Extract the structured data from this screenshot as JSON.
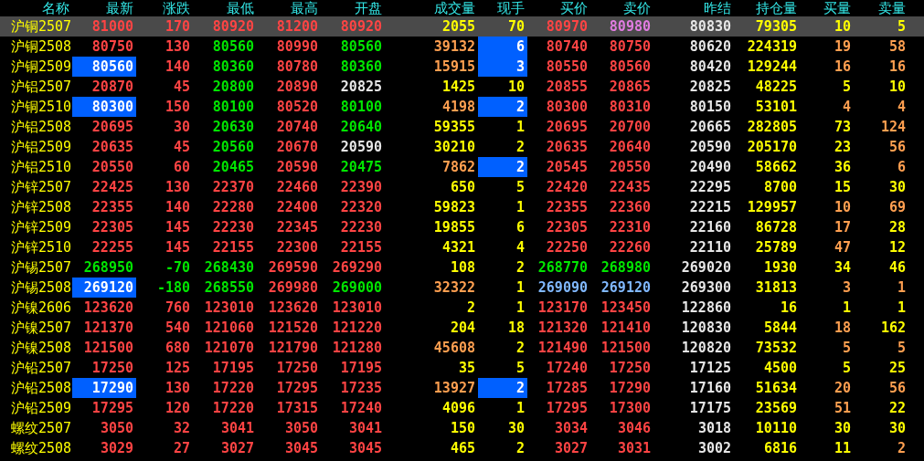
{
  "columns": [
    "名称",
    "最新",
    "涨跌",
    "最低",
    "最高",
    "开盘",
    "成交量",
    "现手",
    "买价",
    "卖价",
    "昨结",
    "持仓量",
    "买量",
    "卖量"
  ],
  "rows": [
    {
      "name": "沪铜2507",
      "selected": true,
      "cells": [
        {
          "text": "81000",
          "color": "#ff4444",
          "highlighted": false
        },
        {
          "text": "170",
          "color": "#ff4444",
          "highlighted": false
        },
        {
          "text": "80920",
          "color": "#ff4444",
          "highlighted": false
        },
        {
          "text": "81200",
          "color": "#ff4444",
          "highlighted": false
        },
        {
          "text": "80920",
          "color": "#ff4444",
          "highlighted": false
        },
        {
          "text": "2055",
          "color": "#ffff00",
          "highlighted": false
        },
        {
          "text": "70",
          "color": "#ffff00",
          "highlighted": false
        },
        {
          "text": "80970",
          "color": "#ff4444",
          "highlighted": false
        },
        {
          "text": "80980",
          "color": "#e07ce0",
          "highlighted": false
        },
        {
          "text": "80830",
          "color": "#e6e6e6",
          "highlighted": false
        },
        {
          "text": "79305",
          "color": "#ffff00",
          "highlighted": false
        },
        {
          "text": "10",
          "color": "#ffff00",
          "highlighted": false
        },
        {
          "text": "5",
          "color": "#ffff00",
          "highlighted": false
        }
      ]
    },
    {
      "name": "沪铜2508",
      "selected": false,
      "cells": [
        {
          "text": "80750",
          "color": "#ff4444",
          "highlighted": false
        },
        {
          "text": "130",
          "color": "#ff4444",
          "highlighted": false
        },
        {
          "text": "80560",
          "color": "#00e600",
          "highlighted": false
        },
        {
          "text": "80990",
          "color": "#ff4444",
          "highlighted": false
        },
        {
          "text": "80560",
          "color": "#00e600",
          "highlighted": false
        },
        {
          "text": "39132",
          "color": "#ff9f50",
          "highlighted": false
        },
        {
          "text": "6",
          "color": "#ffffff",
          "highlighted": true
        },
        {
          "text": "80740",
          "color": "#ff4444",
          "highlighted": false
        },
        {
          "text": "80750",
          "color": "#ff4444",
          "highlighted": false
        },
        {
          "text": "80620",
          "color": "#e6e6e6",
          "highlighted": false
        },
        {
          "text": "224319",
          "color": "#ffff00",
          "highlighted": false
        },
        {
          "text": "19",
          "color": "#ff9f50",
          "highlighted": false
        },
        {
          "text": "58",
          "color": "#ff9f50",
          "highlighted": false
        }
      ]
    },
    {
      "name": "沪铜2509",
      "selected": false,
      "cells": [
        {
          "text": "80560",
          "color": "#ffffff",
          "highlighted": true
        },
        {
          "text": "140",
          "color": "#ff4444",
          "highlighted": false
        },
        {
          "text": "80360",
          "color": "#00e600",
          "highlighted": false
        },
        {
          "text": "80780",
          "color": "#ff4444",
          "highlighted": false
        },
        {
          "text": "80360",
          "color": "#00e600",
          "highlighted": false
        },
        {
          "text": "15915",
          "color": "#ff9f50",
          "highlighted": false
        },
        {
          "text": "3",
          "color": "#ffffff",
          "highlighted": true
        },
        {
          "text": "80550",
          "color": "#ff4444",
          "highlighted": false
        },
        {
          "text": "80560",
          "color": "#ff4444",
          "highlighted": false
        },
        {
          "text": "80420",
          "color": "#e6e6e6",
          "highlighted": false
        },
        {
          "text": "129244",
          "color": "#ffff00",
          "highlighted": false
        },
        {
          "text": "16",
          "color": "#ff9f50",
          "highlighted": false
        },
        {
          "text": "16",
          "color": "#ff9f50",
          "highlighted": false
        }
      ]
    },
    {
      "name": "沪铝2507",
      "selected": false,
      "cells": [
        {
          "text": "20870",
          "color": "#ff4444",
          "highlighted": false
        },
        {
          "text": "45",
          "color": "#ff4444",
          "highlighted": false
        },
        {
          "text": "20800",
          "color": "#00e600",
          "highlighted": false
        },
        {
          "text": "20890",
          "color": "#ff4444",
          "highlighted": false
        },
        {
          "text": "20825",
          "color": "#e6e6e6",
          "highlighted": false
        },
        {
          "text": "1425",
          "color": "#ffff00",
          "highlighted": false
        },
        {
          "text": "10",
          "color": "#ffff00",
          "highlighted": false
        },
        {
          "text": "20855",
          "color": "#ff4444",
          "highlighted": false
        },
        {
          "text": "20865",
          "color": "#ff4444",
          "highlighted": false
        },
        {
          "text": "20825",
          "color": "#e6e6e6",
          "highlighted": false
        },
        {
          "text": "48225",
          "color": "#ffff00",
          "highlighted": false
        },
        {
          "text": "5",
          "color": "#ffff00",
          "highlighted": false
        },
        {
          "text": "10",
          "color": "#ffff00",
          "highlighted": false
        }
      ]
    },
    {
      "name": "沪铜2510",
      "selected": false,
      "cells": [
        {
          "text": "80300",
          "color": "#ffffff",
          "highlighted": true
        },
        {
          "text": "150",
          "color": "#ff4444",
          "highlighted": false
        },
        {
          "text": "80100",
          "color": "#00e600",
          "highlighted": false
        },
        {
          "text": "80520",
          "color": "#ff4444",
          "highlighted": false
        },
        {
          "text": "80100",
          "color": "#00e600",
          "highlighted": false
        },
        {
          "text": "4198",
          "color": "#ff9f50",
          "highlighted": false
        },
        {
          "text": "2",
          "color": "#ffffff",
          "highlighted": true
        },
        {
          "text": "80300",
          "color": "#ff4444",
          "highlighted": false
        },
        {
          "text": "80310",
          "color": "#ff4444",
          "highlighted": false
        },
        {
          "text": "80150",
          "color": "#e6e6e6",
          "highlighted": false
        },
        {
          "text": "53101",
          "color": "#ffff00",
          "highlighted": false
        },
        {
          "text": "4",
          "color": "#ff9f50",
          "highlighted": false
        },
        {
          "text": "4",
          "color": "#ff9f50",
          "highlighted": false
        }
      ]
    },
    {
      "name": "沪铝2508",
      "selected": false,
      "cells": [
        {
          "text": "20695",
          "color": "#ff4444",
          "highlighted": false
        },
        {
          "text": "30",
          "color": "#ff4444",
          "highlighted": false
        },
        {
          "text": "20630",
          "color": "#00e600",
          "highlighted": false
        },
        {
          "text": "20740",
          "color": "#ff4444",
          "highlighted": false
        },
        {
          "text": "20640",
          "color": "#00e600",
          "highlighted": false
        },
        {
          "text": "59355",
          "color": "#ffff00",
          "highlighted": false
        },
        {
          "text": "1",
          "color": "#ffff00",
          "highlighted": false
        },
        {
          "text": "20695",
          "color": "#ff4444",
          "highlighted": false
        },
        {
          "text": "20700",
          "color": "#ff4444",
          "highlighted": false
        },
        {
          "text": "20665",
          "color": "#e6e6e6",
          "highlighted": false
        },
        {
          "text": "282805",
          "color": "#ffff00",
          "highlighted": false
        },
        {
          "text": "73",
          "color": "#ffff00",
          "highlighted": false
        },
        {
          "text": "124",
          "color": "#ff9f50",
          "highlighted": false
        }
      ]
    },
    {
      "name": "沪铝2509",
      "selected": false,
      "cells": [
        {
          "text": "20635",
          "color": "#ff4444",
          "highlighted": false
        },
        {
          "text": "45",
          "color": "#ff4444",
          "highlighted": false
        },
        {
          "text": "20560",
          "color": "#00e600",
          "highlighted": false
        },
        {
          "text": "20670",
          "color": "#ff4444",
          "highlighted": false
        },
        {
          "text": "20590",
          "color": "#e6e6e6",
          "highlighted": false
        },
        {
          "text": "30210",
          "color": "#ffff00",
          "highlighted": false
        },
        {
          "text": "2",
          "color": "#ffff00",
          "highlighted": false
        },
        {
          "text": "20635",
          "color": "#ff4444",
          "highlighted": false
        },
        {
          "text": "20640",
          "color": "#ff4444",
          "highlighted": false
        },
        {
          "text": "20590",
          "color": "#e6e6e6",
          "highlighted": false
        },
        {
          "text": "205170",
          "color": "#ffff00",
          "highlighted": false
        },
        {
          "text": "23",
          "color": "#ffff00",
          "highlighted": false
        },
        {
          "text": "56",
          "color": "#ff9f50",
          "highlighted": false
        }
      ]
    },
    {
      "name": "沪铝2510",
      "selected": false,
      "cells": [
        {
          "text": "20550",
          "color": "#ff4444",
          "highlighted": false
        },
        {
          "text": "60",
          "color": "#ff4444",
          "highlighted": false
        },
        {
          "text": "20465",
          "color": "#00e600",
          "highlighted": false
        },
        {
          "text": "20590",
          "color": "#ff4444",
          "highlighted": false
        },
        {
          "text": "20475",
          "color": "#00e600",
          "highlighted": false
        },
        {
          "text": "7862",
          "color": "#ff9f50",
          "highlighted": false
        },
        {
          "text": "2",
          "color": "#ffffff",
          "highlighted": true
        },
        {
          "text": "20545",
          "color": "#ff4444",
          "highlighted": false
        },
        {
          "text": "20550",
          "color": "#ff4444",
          "highlighted": false
        },
        {
          "text": "20490",
          "color": "#e6e6e6",
          "highlighted": false
        },
        {
          "text": "58662",
          "color": "#ffff00",
          "highlighted": false
        },
        {
          "text": "36",
          "color": "#ffff00",
          "highlighted": false
        },
        {
          "text": "6",
          "color": "#ff9f50",
          "highlighted": false
        }
      ]
    },
    {
      "name": "沪锌2507",
      "selected": false,
      "cells": [
        {
          "text": "22425",
          "color": "#ff4444",
          "highlighted": false
        },
        {
          "text": "130",
          "color": "#ff4444",
          "highlighted": false
        },
        {
          "text": "22370",
          "color": "#ff4444",
          "highlighted": false
        },
        {
          "text": "22460",
          "color": "#ff4444",
          "highlighted": false
        },
        {
          "text": "22390",
          "color": "#ff4444",
          "highlighted": false
        },
        {
          "text": "650",
          "color": "#ffff00",
          "highlighted": false
        },
        {
          "text": "5",
          "color": "#ffff00",
          "highlighted": false
        },
        {
          "text": "22420",
          "color": "#ff4444",
          "highlighted": false
        },
        {
          "text": "22435",
          "color": "#ff4444",
          "highlighted": false
        },
        {
          "text": "22295",
          "color": "#e6e6e6",
          "highlighted": false
        },
        {
          "text": "8700",
          "color": "#ffff00",
          "highlighted": false
        },
        {
          "text": "15",
          "color": "#ffff00",
          "highlighted": false
        },
        {
          "text": "30",
          "color": "#ffff00",
          "highlighted": false
        }
      ]
    },
    {
      "name": "沪锌2508",
      "selected": false,
      "cells": [
        {
          "text": "22355",
          "color": "#ff4444",
          "highlighted": false
        },
        {
          "text": "140",
          "color": "#ff4444",
          "highlighted": false
        },
        {
          "text": "22280",
          "color": "#ff4444",
          "highlighted": false
        },
        {
          "text": "22400",
          "color": "#ff4444",
          "highlighted": false
        },
        {
          "text": "22320",
          "color": "#ff4444",
          "highlighted": false
        },
        {
          "text": "59823",
          "color": "#ffff00",
          "highlighted": false
        },
        {
          "text": "1",
          "color": "#ffff00",
          "highlighted": false
        },
        {
          "text": "22355",
          "color": "#ff4444",
          "highlighted": false
        },
        {
          "text": "22360",
          "color": "#ff4444",
          "highlighted": false
        },
        {
          "text": "22215",
          "color": "#e6e6e6",
          "highlighted": false
        },
        {
          "text": "129957",
          "color": "#ffff00",
          "highlighted": false
        },
        {
          "text": "10",
          "color": "#ff9f50",
          "highlighted": false
        },
        {
          "text": "69",
          "color": "#ff9f50",
          "highlighted": false
        }
      ]
    },
    {
      "name": "沪锌2509",
      "selected": false,
      "cells": [
        {
          "text": "22305",
          "color": "#ff4444",
          "highlighted": false
        },
        {
          "text": "145",
          "color": "#ff4444",
          "highlighted": false
        },
        {
          "text": "22230",
          "color": "#ff4444",
          "highlighted": false
        },
        {
          "text": "22345",
          "color": "#ff4444",
          "highlighted": false
        },
        {
          "text": "22230",
          "color": "#ff4444",
          "highlighted": false
        },
        {
          "text": "19855",
          "color": "#ffff00",
          "highlighted": false
        },
        {
          "text": "6",
          "color": "#ffff00",
          "highlighted": false
        },
        {
          "text": "22305",
          "color": "#ff4444",
          "highlighted": false
        },
        {
          "text": "22310",
          "color": "#ff4444",
          "highlighted": false
        },
        {
          "text": "22160",
          "color": "#e6e6e6",
          "highlighted": false
        },
        {
          "text": "86728",
          "color": "#ffff00",
          "highlighted": false
        },
        {
          "text": "17",
          "color": "#ff9f50",
          "highlighted": false
        },
        {
          "text": "28",
          "color": "#ffff00",
          "highlighted": false
        }
      ]
    },
    {
      "name": "沪锌2510",
      "selected": false,
      "cells": [
        {
          "text": "22255",
          "color": "#ff4444",
          "highlighted": false
        },
        {
          "text": "145",
          "color": "#ff4444",
          "highlighted": false
        },
        {
          "text": "22155",
          "color": "#ff4444",
          "highlighted": false
        },
        {
          "text": "22300",
          "color": "#ff4444",
          "highlighted": false
        },
        {
          "text": "22155",
          "color": "#ff4444",
          "highlighted": false
        },
        {
          "text": "4321",
          "color": "#ffff00",
          "highlighted": false
        },
        {
          "text": "4",
          "color": "#ffff00",
          "highlighted": false
        },
        {
          "text": "22250",
          "color": "#ff4444",
          "highlighted": false
        },
        {
          "text": "22260",
          "color": "#ff4444",
          "highlighted": false
        },
        {
          "text": "22110",
          "color": "#e6e6e6",
          "highlighted": false
        },
        {
          "text": "25789",
          "color": "#ffff00",
          "highlighted": false
        },
        {
          "text": "47",
          "color": "#ff9f50",
          "highlighted": false
        },
        {
          "text": "12",
          "color": "#ffff00",
          "highlighted": false
        }
      ]
    },
    {
      "name": "沪锡2507",
      "selected": false,
      "cells": [
        {
          "text": "268950",
          "color": "#00e600",
          "highlighted": false
        },
        {
          "text": "-70",
          "color": "#00e600",
          "highlighted": false
        },
        {
          "text": "268430",
          "color": "#00e600",
          "highlighted": false
        },
        {
          "text": "269590",
          "color": "#ff4444",
          "highlighted": false
        },
        {
          "text": "269290",
          "color": "#ff4444",
          "highlighted": false
        },
        {
          "text": "108",
          "color": "#ffff00",
          "highlighted": false
        },
        {
          "text": "2",
          "color": "#ffff00",
          "highlighted": false
        },
        {
          "text": "268770",
          "color": "#00e600",
          "highlighted": false
        },
        {
          "text": "268980",
          "color": "#00e600",
          "highlighted": false
        },
        {
          "text": "269020",
          "color": "#e6e6e6",
          "highlighted": false
        },
        {
          "text": "1930",
          "color": "#ffff00",
          "highlighted": false
        },
        {
          "text": "34",
          "color": "#ffff00",
          "highlighted": false
        },
        {
          "text": "46",
          "color": "#ffff00",
          "highlighted": false
        }
      ]
    },
    {
      "name": "沪锡2508",
      "selected": false,
      "cells": [
        {
          "text": "269120",
          "color": "#ffffff",
          "highlighted": true
        },
        {
          "text": "-180",
          "color": "#00e600",
          "highlighted": false
        },
        {
          "text": "268550",
          "color": "#00e600",
          "highlighted": false
        },
        {
          "text": "269980",
          "color": "#ff4444",
          "highlighted": false
        },
        {
          "text": "269000",
          "color": "#00e600",
          "highlighted": false
        },
        {
          "text": "32322",
          "color": "#ff9f50",
          "highlighted": false
        },
        {
          "text": "1",
          "color": "#ffff00",
          "highlighted": false
        },
        {
          "text": "269090",
          "color": "#80b8ff",
          "highlighted": false
        },
        {
          "text": "269120",
          "color": "#80b8ff",
          "highlighted": false
        },
        {
          "text": "269300",
          "color": "#e6e6e6",
          "highlighted": false
        },
        {
          "text": "31813",
          "color": "#ffff00",
          "highlighted": false
        },
        {
          "text": "3",
          "color": "#ff9f50",
          "highlighted": false
        },
        {
          "text": "1",
          "color": "#ff9f50",
          "highlighted": false
        }
      ]
    },
    {
      "name": "沪镍2606",
      "selected": false,
      "cells": [
        {
          "text": "123620",
          "color": "#ff4444",
          "highlighted": false
        },
        {
          "text": "760",
          "color": "#ff4444",
          "highlighted": false
        },
        {
          "text": "123010",
          "color": "#ff4444",
          "highlighted": false
        },
        {
          "text": "123620",
          "color": "#ff4444",
          "highlighted": false
        },
        {
          "text": "123010",
          "color": "#ff4444",
          "highlighted": false
        },
        {
          "text": "2",
          "color": "#ffff00",
          "highlighted": false
        },
        {
          "text": "1",
          "color": "#ffff00",
          "highlighted": false
        },
        {
          "text": "123170",
          "color": "#ff4444",
          "highlighted": false
        },
        {
          "text": "123450",
          "color": "#ff4444",
          "highlighted": false
        },
        {
          "text": "122860",
          "color": "#e6e6e6",
          "highlighted": false
        },
        {
          "text": "16",
          "color": "#ffff00",
          "highlighted": false
        },
        {
          "text": "1",
          "color": "#ffff00",
          "highlighted": false
        },
        {
          "text": "1",
          "color": "#ffff00",
          "highlighted": false
        }
      ]
    },
    {
      "name": "沪镍2507",
      "selected": false,
      "cells": [
        {
          "text": "121370",
          "color": "#ff4444",
          "highlighted": false
        },
        {
          "text": "540",
          "color": "#ff4444",
          "highlighted": false
        },
        {
          "text": "121060",
          "color": "#ff4444",
          "highlighted": false
        },
        {
          "text": "121520",
          "color": "#ff4444",
          "highlighted": false
        },
        {
          "text": "121220",
          "color": "#ff4444",
          "highlighted": false
        },
        {
          "text": "204",
          "color": "#ffff00",
          "highlighted": false
        },
        {
          "text": "18",
          "color": "#ffff00",
          "highlighted": false
        },
        {
          "text": "121320",
          "color": "#ff4444",
          "highlighted": false
        },
        {
          "text": "121410",
          "color": "#ff4444",
          "highlighted": false
        },
        {
          "text": "120830",
          "color": "#e6e6e6",
          "highlighted": false
        },
        {
          "text": "5844",
          "color": "#ffff00",
          "highlighted": false
        },
        {
          "text": "18",
          "color": "#ff9f50",
          "highlighted": false
        },
        {
          "text": "162",
          "color": "#ffff00",
          "highlighted": false
        }
      ]
    },
    {
      "name": "沪镍2508",
      "selected": false,
      "cells": [
        {
          "text": "121500",
          "color": "#ff4444",
          "highlighted": false
        },
        {
          "text": "680",
          "color": "#ff4444",
          "highlighted": false
        },
        {
          "text": "121070",
          "color": "#ff4444",
          "highlighted": false
        },
        {
          "text": "121790",
          "color": "#ff4444",
          "highlighted": false
        },
        {
          "text": "121280",
          "color": "#ff4444",
          "highlighted": false
        },
        {
          "text": "45608",
          "color": "#ff9f50",
          "highlighted": false
        },
        {
          "text": "2",
          "color": "#ffff00",
          "highlighted": false
        },
        {
          "text": "121490",
          "color": "#ff4444",
          "highlighted": false
        },
        {
          "text": "121500",
          "color": "#ff4444",
          "highlighted": false
        },
        {
          "text": "120820",
          "color": "#e6e6e6",
          "highlighted": false
        },
        {
          "text": "73532",
          "color": "#ffff00",
          "highlighted": false
        },
        {
          "text": "5",
          "color": "#ff9f50",
          "highlighted": false
        },
        {
          "text": "5",
          "color": "#ff9f50",
          "highlighted": false
        }
      ]
    },
    {
      "name": "沪铅2507",
      "selected": false,
      "cells": [
        {
          "text": "17250",
          "color": "#ff4444",
          "highlighted": false
        },
        {
          "text": "125",
          "color": "#ff4444",
          "highlighted": false
        },
        {
          "text": "17195",
          "color": "#ff4444",
          "highlighted": false
        },
        {
          "text": "17250",
          "color": "#ff4444",
          "highlighted": false
        },
        {
          "text": "17195",
          "color": "#ff4444",
          "highlighted": false
        },
        {
          "text": "35",
          "color": "#ffff00",
          "highlighted": false
        },
        {
          "text": "5",
          "color": "#ffff00",
          "highlighted": false
        },
        {
          "text": "17240",
          "color": "#ff4444",
          "highlighted": false
        },
        {
          "text": "17250",
          "color": "#ff4444",
          "highlighted": false
        },
        {
          "text": "17125",
          "color": "#e6e6e6",
          "highlighted": false
        },
        {
          "text": "4500",
          "color": "#ffff00",
          "highlighted": false
        },
        {
          "text": "5",
          "color": "#ffff00",
          "highlighted": false
        },
        {
          "text": "25",
          "color": "#ffff00",
          "highlighted": false
        }
      ]
    },
    {
      "name": "沪铅2508",
      "selected": false,
      "cells": [
        {
          "text": "17290",
          "color": "#ffffff",
          "highlighted": true
        },
        {
          "text": "130",
          "color": "#ff4444",
          "highlighted": false
        },
        {
          "text": "17220",
          "color": "#ff4444",
          "highlighted": false
        },
        {
          "text": "17295",
          "color": "#ff4444",
          "highlighted": false
        },
        {
          "text": "17235",
          "color": "#ff4444",
          "highlighted": false
        },
        {
          "text": "13927",
          "color": "#ff9f50",
          "highlighted": false
        },
        {
          "text": "2",
          "color": "#ffffff",
          "highlighted": true
        },
        {
          "text": "17285",
          "color": "#ff4444",
          "highlighted": false
        },
        {
          "text": "17290",
          "color": "#ff4444",
          "highlighted": false
        },
        {
          "text": "17160",
          "color": "#e6e6e6",
          "highlighted": false
        },
        {
          "text": "51634",
          "color": "#ffff00",
          "highlighted": false
        },
        {
          "text": "20",
          "color": "#ff9f50",
          "highlighted": false
        },
        {
          "text": "56",
          "color": "#ff9f50",
          "highlighted": false
        }
      ]
    },
    {
      "name": "沪铅2509",
      "selected": false,
      "cells": [
        {
          "text": "17295",
          "color": "#ff4444",
          "highlighted": false
        },
        {
          "text": "120",
          "color": "#ff4444",
          "highlighted": false
        },
        {
          "text": "17220",
          "color": "#ff4444",
          "highlighted": false
        },
        {
          "text": "17315",
          "color": "#ff4444",
          "highlighted": false
        },
        {
          "text": "17240",
          "color": "#ff4444",
          "highlighted": false
        },
        {
          "text": "4096",
          "color": "#ffff00",
          "highlighted": false
        },
        {
          "text": "1",
          "color": "#ffff00",
          "highlighted": false
        },
        {
          "text": "17295",
          "color": "#ff4444",
          "highlighted": false
        },
        {
          "text": "17300",
          "color": "#ff4444",
          "highlighted": false
        },
        {
          "text": "17175",
          "color": "#e6e6e6",
          "highlighted": false
        },
        {
          "text": "23569",
          "color": "#ffff00",
          "highlighted": false
        },
        {
          "text": "51",
          "color": "#ff9f50",
          "highlighted": false
        },
        {
          "text": "22",
          "color": "#ffff00",
          "highlighted": false
        }
      ]
    },
    {
      "name": "螺纹2507",
      "selected": false,
      "cells": [
        {
          "text": "3050",
          "color": "#ff4444",
          "highlighted": false
        },
        {
          "text": "32",
          "color": "#ff4444",
          "highlighted": false
        },
        {
          "text": "3041",
          "color": "#ff4444",
          "highlighted": false
        },
        {
          "text": "3050",
          "color": "#ff4444",
          "highlighted": false
        },
        {
          "text": "3041",
          "color": "#ff4444",
          "highlighted": false
        },
        {
          "text": "150",
          "color": "#ffff00",
          "highlighted": false
        },
        {
          "text": "30",
          "color": "#ffff00",
          "highlighted": false
        },
        {
          "text": "3034",
          "color": "#ff4444",
          "highlighted": false
        },
        {
          "text": "3046",
          "color": "#ff4444",
          "highlighted": false
        },
        {
          "text": "3018",
          "color": "#e6e6e6",
          "highlighted": false
        },
        {
          "text": "10110",
          "color": "#ffff00",
          "highlighted": false
        },
        {
          "text": "30",
          "color": "#ffff00",
          "highlighted": false
        },
        {
          "text": "30",
          "color": "#ffff00",
          "highlighted": false
        }
      ]
    },
    {
      "name": "螺纹2508",
      "selected": false,
      "cells": [
        {
          "text": "3029",
          "color": "#ff4444",
          "highlighted": false
        },
        {
          "text": "27",
          "color": "#ff4444",
          "highlighted": false
        },
        {
          "text": "3027",
          "color": "#ff4444",
          "highlighted": false
        },
        {
          "text": "3045",
          "color": "#ff4444",
          "highlighted": false
        },
        {
          "text": "3045",
          "color": "#ff4444",
          "highlighted": false
        },
        {
          "text": "465",
          "color": "#ffff00",
          "highlighted": false
        },
        {
          "text": "2",
          "color": "#ffff00",
          "highlighted": false
        },
        {
          "text": "3027",
          "color": "#ff4444",
          "highlighted": false
        },
        {
          "text": "3031",
          "color": "#ff4444",
          "highlighted": false
        },
        {
          "text": "3002",
          "color": "#e6e6e6",
          "highlighted": false
        },
        {
          "text": "6816",
          "color": "#ffff00",
          "highlighted": false
        },
        {
          "text": "11",
          "color": "#ffff00",
          "highlighted": false
        },
        {
          "text": "2",
          "color": "#ff9f50",
          "highlighted": false
        }
      ]
    }
  ]
}
